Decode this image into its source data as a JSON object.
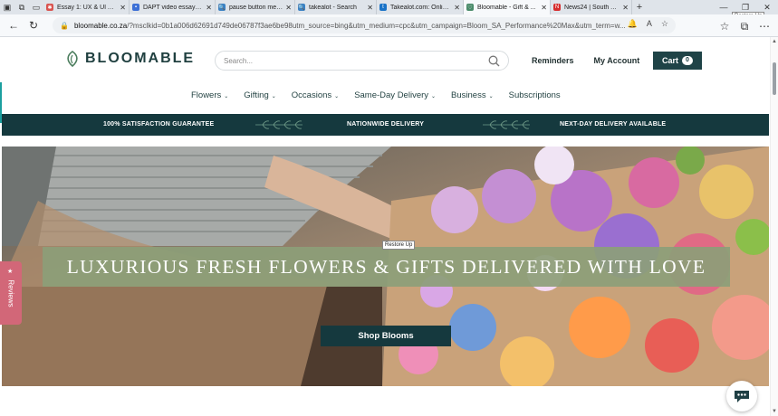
{
  "browser": {
    "tabs": [
      {
        "title": "Essay 1: UX & UI An...",
        "fav_color": "#d9534f",
        "fav_glyph": "✱"
      },
      {
        "title": "DAPT video essay - ...",
        "fav_color": "#3b6fd6",
        "fav_glyph": "▪"
      },
      {
        "title": "pause button menu ...",
        "fav_color": "#3b82c4",
        "fav_glyph": "🔍"
      },
      {
        "title": "takealot - Search",
        "fav_color": "#3b82c4",
        "fav_glyph": "🔍"
      },
      {
        "title": "Takealot.com: Online ...",
        "fav_color": "#1a73c7",
        "fav_glyph": "t"
      },
      {
        "title": "Bloomable - Gift & ...",
        "fav_color": "#4a8b6a",
        "fav_glyph": "♡"
      },
      {
        "title": "News24 | South Afric...",
        "fav_color": "#d62d2d",
        "fav_glyph": "N"
      }
    ],
    "tooltip": "Restore Up",
    "url_host": "bloomable.co.za",
    "url_rest": "/?msclkid=0b1a006d62691d749de06787f3ae6be98utm_source=bing&utm_medium=cpc&utm_campaign=Bloom_SA_Performance%20Max&utm_term=w..."
  },
  "site": {
    "logo": "BLOOMABLE",
    "search_placeholder": "Search...",
    "reminders": "Reminders",
    "my_account": "My Account",
    "cart_label": "Cart",
    "cart_count": "0",
    "nav": [
      {
        "label": "Flowers",
        "dropdown": true
      },
      {
        "label": "Gifting",
        "dropdown": true
      },
      {
        "label": "Occasions",
        "dropdown": true
      },
      {
        "label": "Same-Day Delivery",
        "dropdown": true
      },
      {
        "label": "Business",
        "dropdown": true
      },
      {
        "label": "Subscriptions",
        "dropdown": false
      }
    ],
    "usp": [
      "100% SATISFACTION GUARANTEE",
      "NATIONWIDE DELIVERY",
      "NEXT-DAY DELIVERY AVAILABLE"
    ],
    "hero_headline": "LUXURIOUS FRESH FLOWERS & GIFTS DELIVERED WITH LOVE",
    "hero_cta": "Shop Blooms",
    "hero_tooltip": "Restore Up",
    "reviews_label": "Reviews",
    "colors": {
      "brand_dark": "#15393e",
      "reviews_pink": "#d26778",
      "headline_band": "#8c9e78"
    }
  }
}
